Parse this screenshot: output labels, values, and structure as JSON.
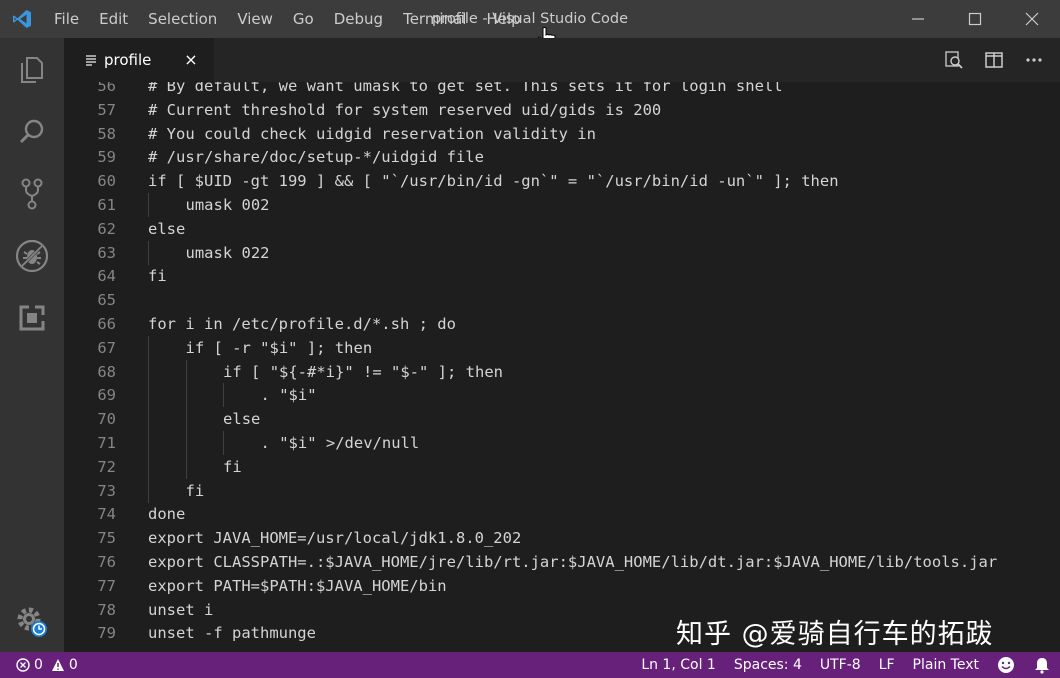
{
  "window": {
    "title": "profile - Visual Studio Code",
    "menu": [
      "File",
      "Edit",
      "Selection",
      "View",
      "Go",
      "Debug",
      "Terminal",
      "Help"
    ],
    "controls": [
      "minimize-icon",
      "maximize-icon",
      "close-icon"
    ]
  },
  "activity_bar": [
    "explorer-icon",
    "search-icon",
    "source-control-icon",
    "debug-icon",
    "extensions-icon",
    "settings-gear-icon"
  ],
  "tab": {
    "label": "profile",
    "close": "×"
  },
  "editor_actions": [
    "open-preview-icon",
    "split-editor-icon",
    "more-actions-icon"
  ],
  "lines": [
    {
      "n": "56",
      "indent": 0,
      "text": "# By default, we want umask to get set. This sets it for login shell"
    },
    {
      "n": "57",
      "indent": 0,
      "text": "# Current threshold for system reserved uid/gids is 200"
    },
    {
      "n": "58",
      "indent": 0,
      "text": "# You could check uidgid reservation validity in"
    },
    {
      "n": "59",
      "indent": 0,
      "text": "# /usr/share/doc/setup-*/uidgid file"
    },
    {
      "n": "60",
      "indent": 0,
      "text": "if [ $UID -gt 199 ] && [ \"`/usr/bin/id -gn`\" = \"`/usr/bin/id -un`\" ]; then"
    },
    {
      "n": "61",
      "indent": 1,
      "text": "umask 002"
    },
    {
      "n": "62",
      "indent": 0,
      "text": "else"
    },
    {
      "n": "63",
      "indent": 1,
      "text": "umask 022"
    },
    {
      "n": "64",
      "indent": 0,
      "text": "fi"
    },
    {
      "n": "65",
      "indent": 0,
      "text": ""
    },
    {
      "n": "66",
      "indent": 0,
      "text": "for i in /etc/profile.d/*.sh ; do"
    },
    {
      "n": "67",
      "indent": 1,
      "text": "if [ -r \"$i\" ]; then"
    },
    {
      "n": "68",
      "indent": 2,
      "text": "if [ \"${-#*i}\" != \"$-\" ]; then"
    },
    {
      "n": "69",
      "indent": 3,
      "text": ". \"$i\""
    },
    {
      "n": "70",
      "indent": 2,
      "text": "else"
    },
    {
      "n": "71",
      "indent": 3,
      "text": ". \"$i\" >/dev/null"
    },
    {
      "n": "72",
      "indent": 2,
      "text": "fi"
    },
    {
      "n": "73",
      "indent": 1,
      "text": "fi"
    },
    {
      "n": "74",
      "indent": 0,
      "text": "done"
    },
    {
      "n": "75",
      "indent": 0,
      "text": "export JAVA_HOME=/usr/local/jdk1.8.0_202"
    },
    {
      "n": "76",
      "indent": 0,
      "text": "export CLASSPATH=.:$JAVA_HOME/jre/lib/rt.jar:$JAVA_HOME/lib/dt.jar:$JAVA_HOME/lib/tools.jar"
    },
    {
      "n": "77",
      "indent": 0,
      "text": "export PATH=$PATH:$JAVA_HOME/bin"
    },
    {
      "n": "78",
      "indent": 0,
      "text": "unset i"
    },
    {
      "n": "79",
      "indent": 0,
      "text": "unset -f pathmunge"
    }
  ],
  "watermark": "知乎 @爱骑自行车的拓跋",
  "status": {
    "errors": "0",
    "warnings": "0",
    "position": "Ln 1, Col 1",
    "spaces": "Spaces: 4",
    "encoding": "UTF-8",
    "eol": "LF",
    "language": "Plain Text"
  },
  "colors": {
    "titlebar": "#3c3c3c",
    "activitybar": "#333333",
    "editor": "#1e1e1e",
    "statusbar": "#68217a",
    "line_number": "#858585",
    "code_text": "#d4d4d4",
    "vscode_blue": "#3a96dd"
  }
}
